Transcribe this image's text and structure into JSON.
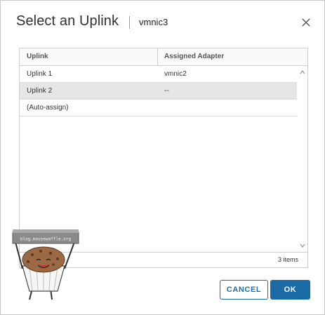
{
  "dialog": {
    "title": "Select an Uplink",
    "subtitle": "vmnic3"
  },
  "grid": {
    "columns": [
      "Uplink",
      "Assigned Adapter"
    ],
    "rows": [
      {
        "uplink": "Uplink 1",
        "adapter": "vmnic2",
        "selected": false
      },
      {
        "uplink": "Uplink 2",
        "adapter": "--",
        "selected": true
      },
      {
        "uplink": "(Auto-assign)",
        "adapter": "",
        "selected": false
      }
    ],
    "footer": "3 items"
  },
  "buttons": {
    "cancel": "CANCEL",
    "ok": "OK"
  },
  "watermark": {
    "text": "blog.mousewaffle.org"
  },
  "colors": {
    "accent": "#1a6aa6",
    "selected_row": "#e6e6e6"
  },
  "icons": {
    "close": "close-icon",
    "scroll_up": "chevron-up-icon",
    "scroll_down": "chevron-down-icon"
  }
}
